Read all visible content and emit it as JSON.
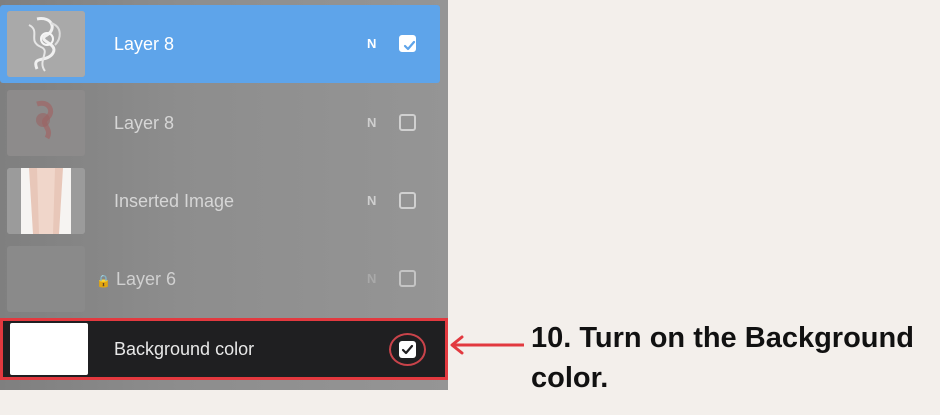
{
  "layers": [
    {
      "name": "Layer 8",
      "blend_mode": "N",
      "visible": true,
      "selected": true,
      "thumbnail": "tattoo-sketch-thumbnail"
    },
    {
      "name": "Layer 8",
      "blend_mode": "N",
      "visible": false,
      "selected": false,
      "thumbnail": "red-sketch-thumbnail"
    },
    {
      "name": "Inserted Image",
      "blend_mode": "N",
      "visible": false,
      "selected": false,
      "thumbnail": "skin-photo-thumbnail"
    },
    {
      "name": "Layer 6",
      "blend_mode": "N",
      "visible": false,
      "selected": false,
      "locked": true,
      "lock_icon": "🔒",
      "thumbnail": "empty-thumbnail"
    }
  ],
  "background_layer": {
    "name": "Background color",
    "visible": true,
    "swatch_color": "#ffffff"
  },
  "instruction": {
    "text": "10. Turn on the Background color."
  },
  "colors": {
    "selected_row": "#5ea4ea",
    "highlight_red": "#e2393f",
    "panel_dark": "#1f1f21"
  }
}
